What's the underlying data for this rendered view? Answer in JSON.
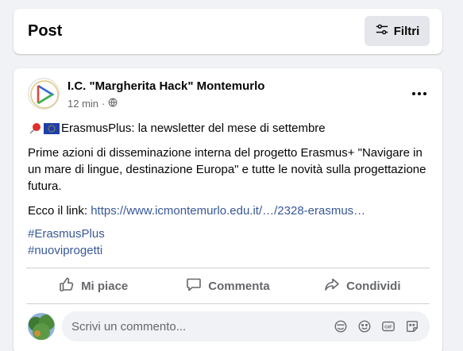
{
  "header": {
    "title": "Post",
    "filter_label": "Filtri"
  },
  "post": {
    "author": "I.C. \"Margherita Hack\" Montemurlo",
    "time": "12 min",
    "separator": "·",
    "line1": "ErasmusPlus: la newsletter del mese di settembre",
    "body": "Prime azioni di disseminazione interna del progetto Erasmus+ \"Navigare in un mare di lingue, destinazione Europa\" e tutte le novità sulla progettazione futura.",
    "link_prefix": "Ecco il link: ",
    "link_text": "https://www.icmontemurlo.edu.it/…/2328-erasmus…",
    "hashtags": [
      "#ErasmusPlus",
      "#nuoviprogetti"
    ]
  },
  "actions": {
    "like": "Mi piace",
    "comment": "Commenta",
    "share": "Condividi"
  },
  "comment": {
    "placeholder": "Scrivi un commento..."
  },
  "colors": {
    "link": "#385898",
    "muted": "#65676b",
    "background": "#f0f2f5"
  },
  "icons": {
    "filter": "sliders-icon",
    "globe": "globe-icon",
    "more": "ellipsis-icon",
    "like": "thumbs-up-icon",
    "comment": "comment-bubble-icon",
    "share": "share-arrow-icon",
    "sticker": "sticker-icon",
    "emoji": "smiley-icon",
    "gif": "gif-icon",
    "avatar_sticker": "avatar-sticker-icon"
  }
}
